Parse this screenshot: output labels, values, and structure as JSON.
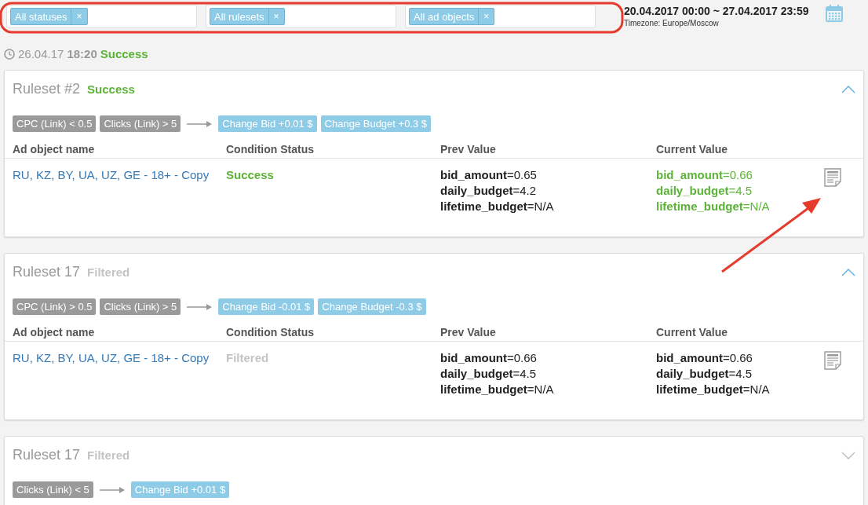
{
  "filters": [
    {
      "tag": "All statuses",
      "remove": "×"
    },
    {
      "tag": "All rulesets",
      "remove": "×"
    },
    {
      "tag": "All ad objects",
      "remove": "×"
    }
  ],
  "date_range": {
    "range": "20.04.2017 00:00 ~ 27.04.2017 23:59",
    "timezone": "Timezone: Europe/Moscow"
  },
  "run": {
    "date": "26.04.17",
    "time": "18:20",
    "status": "Success",
    "color": "#5cb338"
  },
  "rulesets": [
    {
      "title": "Ruleset #2",
      "status": "Success",
      "color": "#5cb338",
      "expanded": true,
      "conditions": [
        "CPC (Link) < 0.5",
        "Clicks (Link) > 5"
      ],
      "actions": [
        "Change Bid +0.01 $",
        "Change Budget +0.3 $"
      ],
      "columns": [
        "Ad object name",
        "Condition Status",
        "Prev Value",
        "Current Value"
      ],
      "rows": [
        {
          "name": "RU, KZ, BY, UA, UZ, GE - 18+ - Copy",
          "status": "Success",
          "color": "#5cb338",
          "changed": true,
          "prev": [
            "**bid_amount**=0.65",
            "**daily_budget**=4.2",
            "**lifetime_budget**=N/A"
          ],
          "current": [
            "**bid_amount**=0.66",
            "**daily_budget**=4.5",
            "**lifetime_budget**=N/A"
          ]
        }
      ]
    },
    {
      "title": "Ruleset 17",
      "status": "Filtered",
      "color": "#c4c4c4",
      "expanded": true,
      "conditions": [
        "CPC (Link) > 0.5",
        "Clicks (Link) > 5"
      ],
      "actions": [
        "Change Bid -0.01 $",
        "Change Budget -0.3 $"
      ],
      "columns": [
        "Ad object name",
        "Condition Status",
        "Prev Value",
        "Current Value"
      ],
      "rows": [
        {
          "name": "RU, KZ, BY, UA, UZ, GE - 18+ - Copy",
          "status": "Filtered",
          "color": "#c4c4c4",
          "changed": false,
          "prev": [
            "**bid_amount**=0.66",
            "**daily_budget**=4.5",
            "**lifetime_budget**=N/A"
          ],
          "current": [
            "**bid_amount**=0.66",
            "**daily_budget**=4.5",
            "**lifetime_budget**=N/A"
          ]
        }
      ]
    },
    {
      "title": "Ruleset 17",
      "status": "Filtered",
      "color": "#c4c4c4",
      "expanded": false,
      "conditions": [
        "Clicks (Link) < 5"
      ],
      "actions": [
        "Change Bid +0.01 $"
      ]
    }
  ]
}
